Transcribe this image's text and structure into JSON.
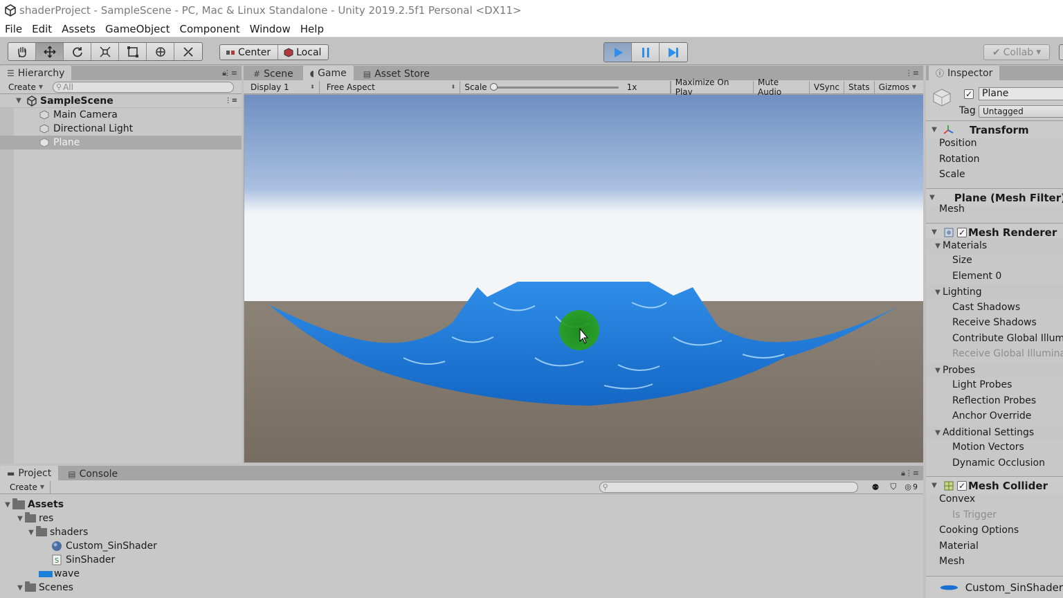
{
  "window": {
    "title": "shaderProject - SampleScene - PC, Mac & Linux Standalone - Unity 2019.2.5f1 Personal <DX11>"
  },
  "menu": [
    "File",
    "Edit",
    "Assets",
    "GameObject",
    "Component",
    "Window",
    "Help"
  ],
  "toolbar": {
    "tools": [
      "hand-icon",
      "move-icon",
      "rotate-icon",
      "scale-icon",
      "rect-icon",
      "transform-icon",
      "custom-tool-icon"
    ],
    "pivot_label": "Center",
    "space_label": "Local",
    "collab_label": "Collab"
  },
  "hierarchy": {
    "tab": "Hierarchy",
    "create_label": "Create",
    "search_placeholder": "All",
    "scene": "SampleScene",
    "items": [
      "Main Camera",
      "Directional Light",
      "Plane"
    ],
    "selected": "Plane"
  },
  "center": {
    "tabs": [
      "Scene",
      "Game",
      "Asset Store"
    ],
    "active_tab": "Game",
    "display": "Display 1",
    "aspect": "Free Aspect",
    "scale_label": "Scale",
    "scale_value": "1x",
    "buttons": [
      "Maximize On Play",
      "Mute Audio",
      "VSync",
      "Stats",
      "Gizmos"
    ]
  },
  "inspector": {
    "tab": "Inspector",
    "object_name": "Plane",
    "tag_label": "Tag",
    "tag_value": "Untagged",
    "transform": {
      "title": "Transform",
      "fields": [
        "Position",
        "Rotation",
        "Scale"
      ]
    },
    "mesh_filter": {
      "title": "Plane (Mesh Filter)",
      "fields": [
        "Mesh"
      ]
    },
    "mesh_renderer": {
      "title": "Mesh Renderer",
      "materials": "Materials",
      "materials_fields": [
        "Size",
        "Element 0"
      ],
      "lighting": "Lighting",
      "lighting_fields": [
        "Cast Shadows",
        "Receive Shadows",
        "Contribute Global Illumination"
      ],
      "lighting_disabled": "Receive Global Illumination",
      "probes": "Probes",
      "probes_fields": [
        "Light Probes",
        "Reflection Probes",
        "Anchor Override"
      ],
      "additional": "Additional Settings",
      "additional_fields": [
        "Motion Vectors",
        "Dynamic Occlusion"
      ]
    },
    "mesh_collider": {
      "title": "Mesh Collider",
      "convex": "Convex",
      "is_trigger": "Is Trigger",
      "fields": [
        "Cooking Options",
        "Material",
        "Mesh"
      ]
    },
    "material_name": "Custom_SinShader"
  },
  "project": {
    "tabs": [
      "Project",
      "Console"
    ],
    "create_label": "Create",
    "hidden_count": "9",
    "tree": {
      "root": "Assets",
      "res": "res",
      "shaders": "shaders",
      "shader_files": [
        "Custom_SinShader",
        "SinShader"
      ],
      "wave": "wave",
      "scenes": "Scenes"
    }
  },
  "colors": {
    "accent_blue": "#2f8ee8",
    "water": "#1a7fd6",
    "cursor_highlight": "#2a9d1f"
  }
}
